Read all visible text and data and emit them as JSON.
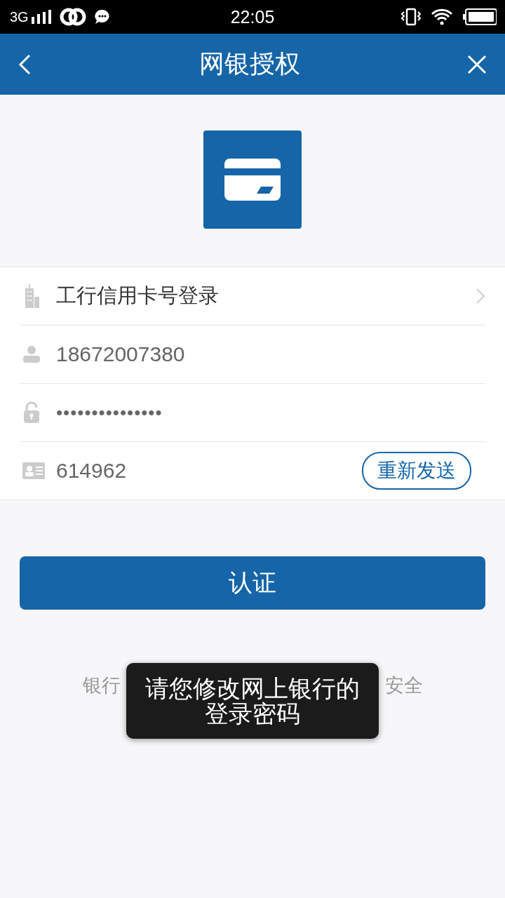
{
  "status_bar": {
    "network": "3G",
    "time": "22:05"
  },
  "nav": {
    "title": "网银授权"
  },
  "form": {
    "rows": [
      {
        "kind": "select",
        "label": "工行信用卡号登录"
      },
      {
        "kind": "account",
        "value": "18672007380"
      },
      {
        "kind": "password",
        "value": "•••••••••••••••"
      },
      {
        "kind": "code",
        "value": "614962",
        "action": "重新发送"
      }
    ]
  },
  "submit": "认证",
  "notice": {
    "start": "银行",
    "end": "安全"
  },
  "toast": {
    "lines": [
      "请您修改网上银行的",
      "登录密码"
    ]
  }
}
